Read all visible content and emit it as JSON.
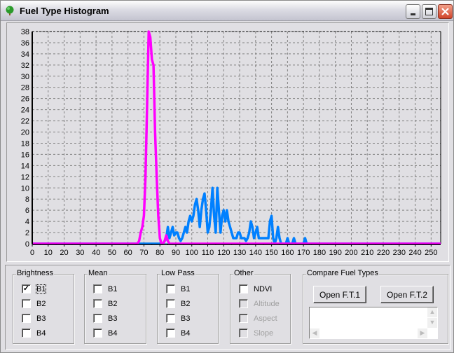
{
  "window": {
    "title": "Fuel Type Histogram",
    "icon": "tree-icon",
    "controls": [
      "minimize",
      "maximize",
      "close"
    ]
  },
  "chart_data": {
    "type": "line",
    "title": "",
    "xlabel": "",
    "ylabel": "",
    "xlim": [
      0,
      256
    ],
    "ylim": [
      0,
      38
    ],
    "xticks": [
      0,
      10,
      20,
      30,
      40,
      50,
      60,
      70,
      80,
      90,
      100,
      110,
      120,
      130,
      140,
      150,
      160,
      170,
      180,
      190,
      200,
      210,
      220,
      230,
      240,
      250
    ],
    "yticks": [
      0,
      2,
      4,
      6,
      8,
      10,
      12,
      14,
      16,
      18,
      20,
      22,
      24,
      26,
      28,
      30,
      32,
      34,
      36,
      38
    ],
    "grid": true,
    "series": [
      {
        "color": "#ff00ff",
        "x": [
          0,
          66,
          67,
          68,
          69,
          70,
          71,
          72,
          73,
          74,
          75,
          76,
          77,
          78,
          79,
          80,
          81,
          82,
          83,
          84,
          85,
          86,
          256
        ],
        "y": [
          0,
          0,
          0.5,
          2,
          3,
          5,
          12,
          25,
          38,
          37,
          33,
          32,
          20,
          12,
          5,
          1,
          0,
          0,
          0.5,
          1.5,
          0.5,
          0,
          0
        ]
      },
      {
        "color": "#0080ff",
        "x": [
          0,
          82,
          83,
          84,
          85,
          86,
          87,
          88,
          89,
          90,
          91,
          92,
          93,
          94,
          95,
          96,
          97,
          98,
          99,
          100,
          101,
          102,
          103,
          104,
          105,
          106,
          107,
          108,
          109,
          110,
          111,
          112,
          113,
          114,
          115,
          116,
          117,
          118,
          119,
          120,
          121,
          122,
          123,
          124,
          125,
          126,
          127,
          128,
          129,
          130,
          131,
          132,
          133,
          134,
          135,
          136,
          137,
          138,
          139,
          140,
          141,
          142,
          143,
          144,
          145,
          146,
          147,
          148,
          149,
          150,
          151,
          152,
          153,
          154,
          155,
          156,
          159,
          160,
          161,
          163,
          164,
          165,
          170,
          171,
          172,
          256
        ],
        "y": [
          0,
          0,
          0.5,
          1,
          3,
          1,
          2,
          3,
          1.5,
          2,
          2,
          1,
          0.5,
          1,
          2,
          3,
          2,
          4,
          5,
          4,
          5,
          7,
          8,
          6,
          3,
          6,
          8,
          9,
          6,
          2,
          3,
          6,
          10,
          5,
          2,
          10,
          6,
          2,
          5,
          6,
          4,
          6,
          4,
          3,
          2,
          1,
          1,
          1,
          2,
          2,
          1,
          1,
          1,
          0.5,
          1,
          2,
          4,
          3,
          1,
          2,
          3,
          1,
          1,
          1,
          1,
          1,
          1,
          1,
          4,
          5,
          1,
          0,
          1,
          3,
          1,
          0,
          0,
          1,
          0,
          0,
          1,
          0,
          0,
          1,
          0,
          0
        ]
      },
      {
        "color": "#00a0a0",
        "x": [
          0,
          256
        ],
        "y": [
          0,
          0
        ]
      }
    ]
  },
  "groups": [
    {
      "label": "Brightness",
      "items": [
        {
          "label": "B1",
          "checked": true,
          "enabled": true,
          "focused": true
        },
        {
          "label": "B2",
          "checked": false,
          "enabled": true
        },
        {
          "label": "B3",
          "checked": false,
          "enabled": true
        },
        {
          "label": "B4",
          "checked": false,
          "enabled": true
        }
      ]
    },
    {
      "label": "Mean",
      "items": [
        {
          "label": "B1",
          "checked": false,
          "enabled": true
        },
        {
          "label": "B2",
          "checked": false,
          "enabled": true
        },
        {
          "label": "B3",
          "checked": false,
          "enabled": true
        },
        {
          "label": "B4",
          "checked": false,
          "enabled": true
        }
      ]
    },
    {
      "label": "Low Pass",
      "items": [
        {
          "label": "B1",
          "checked": false,
          "enabled": true
        },
        {
          "label": "B2",
          "checked": false,
          "enabled": true
        },
        {
          "label": "B3",
          "checked": false,
          "enabled": true
        },
        {
          "label": "B4",
          "checked": false,
          "enabled": true
        }
      ]
    },
    {
      "label": "Other",
      "items": [
        {
          "label": "NDVI",
          "checked": false,
          "enabled": true
        },
        {
          "label": "Altitude",
          "checked": false,
          "enabled": false
        },
        {
          "label": "Aspect",
          "checked": false,
          "enabled": false
        },
        {
          "label": "Slope",
          "checked": false,
          "enabled": false
        }
      ]
    }
  ],
  "compare": {
    "label": "Compare Fuel Types",
    "open1": "Open F.T.1",
    "open2": "Open F.T.2"
  }
}
